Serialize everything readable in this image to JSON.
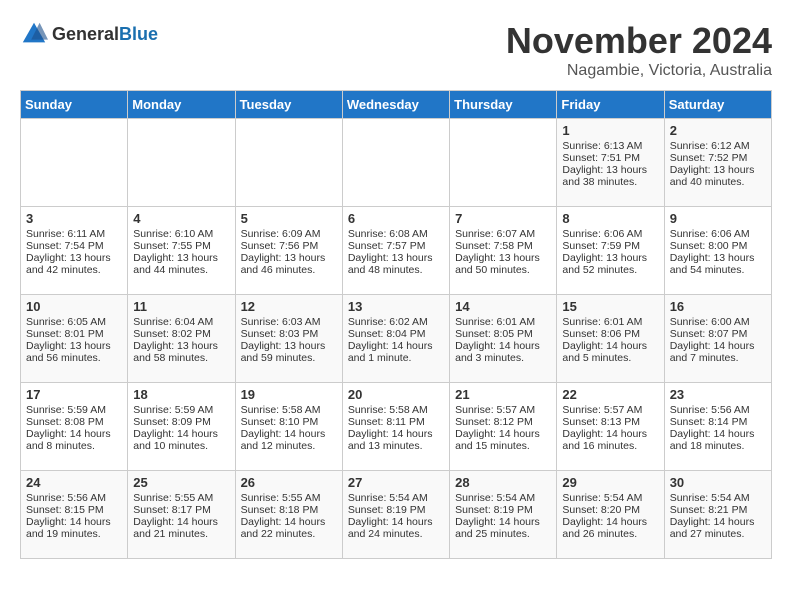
{
  "header": {
    "logo_general": "General",
    "logo_blue": "Blue",
    "month_year": "November 2024",
    "location": "Nagambie, Victoria, Australia"
  },
  "weekdays": [
    "Sunday",
    "Monday",
    "Tuesday",
    "Wednesday",
    "Thursday",
    "Friday",
    "Saturday"
  ],
  "weeks": [
    [
      {
        "day": "",
        "info": ""
      },
      {
        "day": "",
        "info": ""
      },
      {
        "day": "",
        "info": ""
      },
      {
        "day": "",
        "info": ""
      },
      {
        "day": "",
        "info": ""
      },
      {
        "day": "1",
        "info": "Sunrise: 6:13 AM\nSunset: 7:51 PM\nDaylight: 13 hours\nand 38 minutes."
      },
      {
        "day": "2",
        "info": "Sunrise: 6:12 AM\nSunset: 7:52 PM\nDaylight: 13 hours\nand 40 minutes."
      }
    ],
    [
      {
        "day": "3",
        "info": "Sunrise: 6:11 AM\nSunset: 7:54 PM\nDaylight: 13 hours\nand 42 minutes."
      },
      {
        "day": "4",
        "info": "Sunrise: 6:10 AM\nSunset: 7:55 PM\nDaylight: 13 hours\nand 44 minutes."
      },
      {
        "day": "5",
        "info": "Sunrise: 6:09 AM\nSunset: 7:56 PM\nDaylight: 13 hours\nand 46 minutes."
      },
      {
        "day": "6",
        "info": "Sunrise: 6:08 AM\nSunset: 7:57 PM\nDaylight: 13 hours\nand 48 minutes."
      },
      {
        "day": "7",
        "info": "Sunrise: 6:07 AM\nSunset: 7:58 PM\nDaylight: 13 hours\nand 50 minutes."
      },
      {
        "day": "8",
        "info": "Sunrise: 6:06 AM\nSunset: 7:59 PM\nDaylight: 13 hours\nand 52 minutes."
      },
      {
        "day": "9",
        "info": "Sunrise: 6:06 AM\nSunset: 8:00 PM\nDaylight: 13 hours\nand 54 minutes."
      }
    ],
    [
      {
        "day": "10",
        "info": "Sunrise: 6:05 AM\nSunset: 8:01 PM\nDaylight: 13 hours\nand 56 minutes."
      },
      {
        "day": "11",
        "info": "Sunrise: 6:04 AM\nSunset: 8:02 PM\nDaylight: 13 hours\nand 58 minutes."
      },
      {
        "day": "12",
        "info": "Sunrise: 6:03 AM\nSunset: 8:03 PM\nDaylight: 13 hours\nand 59 minutes."
      },
      {
        "day": "13",
        "info": "Sunrise: 6:02 AM\nSunset: 8:04 PM\nDaylight: 14 hours\nand 1 minute."
      },
      {
        "day": "14",
        "info": "Sunrise: 6:01 AM\nSunset: 8:05 PM\nDaylight: 14 hours\nand 3 minutes."
      },
      {
        "day": "15",
        "info": "Sunrise: 6:01 AM\nSunset: 8:06 PM\nDaylight: 14 hours\nand 5 minutes."
      },
      {
        "day": "16",
        "info": "Sunrise: 6:00 AM\nSunset: 8:07 PM\nDaylight: 14 hours\nand 7 minutes."
      }
    ],
    [
      {
        "day": "17",
        "info": "Sunrise: 5:59 AM\nSunset: 8:08 PM\nDaylight: 14 hours\nand 8 minutes."
      },
      {
        "day": "18",
        "info": "Sunrise: 5:59 AM\nSunset: 8:09 PM\nDaylight: 14 hours\nand 10 minutes."
      },
      {
        "day": "19",
        "info": "Sunrise: 5:58 AM\nSunset: 8:10 PM\nDaylight: 14 hours\nand 12 minutes."
      },
      {
        "day": "20",
        "info": "Sunrise: 5:58 AM\nSunset: 8:11 PM\nDaylight: 14 hours\nand 13 minutes."
      },
      {
        "day": "21",
        "info": "Sunrise: 5:57 AM\nSunset: 8:12 PM\nDaylight: 14 hours\nand 15 minutes."
      },
      {
        "day": "22",
        "info": "Sunrise: 5:57 AM\nSunset: 8:13 PM\nDaylight: 14 hours\nand 16 minutes."
      },
      {
        "day": "23",
        "info": "Sunrise: 5:56 AM\nSunset: 8:14 PM\nDaylight: 14 hours\nand 18 minutes."
      }
    ],
    [
      {
        "day": "24",
        "info": "Sunrise: 5:56 AM\nSunset: 8:15 PM\nDaylight: 14 hours\nand 19 minutes."
      },
      {
        "day": "25",
        "info": "Sunrise: 5:55 AM\nSunset: 8:17 PM\nDaylight: 14 hours\nand 21 minutes."
      },
      {
        "day": "26",
        "info": "Sunrise: 5:55 AM\nSunset: 8:18 PM\nDaylight: 14 hours\nand 22 minutes."
      },
      {
        "day": "27",
        "info": "Sunrise: 5:54 AM\nSunset: 8:19 PM\nDaylight: 14 hours\nand 24 minutes."
      },
      {
        "day": "28",
        "info": "Sunrise: 5:54 AM\nSunset: 8:19 PM\nDaylight: 14 hours\nand 25 minutes."
      },
      {
        "day": "29",
        "info": "Sunrise: 5:54 AM\nSunset: 8:20 PM\nDaylight: 14 hours\nand 26 minutes."
      },
      {
        "day": "30",
        "info": "Sunrise: 5:54 AM\nSunset: 8:21 PM\nDaylight: 14 hours\nand 27 minutes."
      }
    ]
  ]
}
